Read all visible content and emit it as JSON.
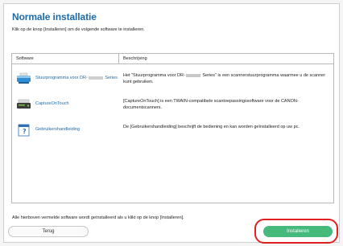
{
  "window": {
    "title": "Normale installatie",
    "subtitle": "Klik op de knop [Installeren] om de volgende software te installeren."
  },
  "table": {
    "headers": {
      "software": "Software",
      "description": "Beschrijving"
    },
    "rows": [
      {
        "name_prefix": "Stuurprogramma voor DR-",
        "name_suffix": " Series",
        "desc_prefix": "Het \"Stuurprogramma voor DR-",
        "desc_suffix": " Series\" is een scannerstuurprogramma waarmee u de scanner kunt gebruiken.",
        "icon": "scanner-driver-icon"
      },
      {
        "name": "CaptureOnTouch",
        "description": "[CaptureOnTouch] is een TWAIN-compatibele scantoepassingssoftware voor de CANON-documentscanners.",
        "icon": "capture-on-touch-icon"
      },
      {
        "name": "Gebruikershandleiding",
        "description": "De [Gebruikershandleiding] beschrijft de bediening en kan worden geïnstalleerd op uw pc.",
        "icon": "user-manual-icon"
      }
    ]
  },
  "footer": {
    "note": "Alle hierboven vermelde software wordt geïnstalleerd als u klikt op de knop [Installeren].",
    "back_label": "Terug",
    "install_label": "Installeren"
  },
  "colors": {
    "title": "#1d6aa9",
    "install_button": "#46b97d",
    "highlight": "#e0201e"
  }
}
